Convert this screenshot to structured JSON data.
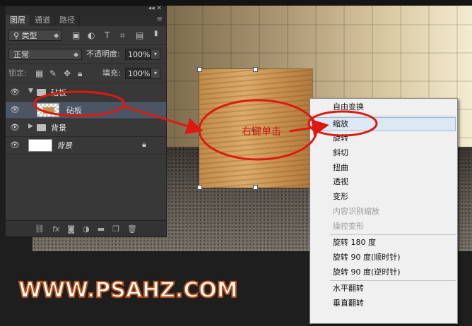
{
  "panel": {
    "tabs": [
      "图层",
      "通道",
      "路径"
    ],
    "filter_kind": "类型",
    "blend_mode": "正常",
    "opacity_label": "不透明度:",
    "opacity_value": "100%",
    "lock_label": "锁定:",
    "fill_label": "填充:",
    "fill_value": "100%",
    "layers": [
      {
        "name": "砧板",
        "type": "group",
        "visible": true
      },
      {
        "name": "砧板",
        "type": "layer",
        "visible": true,
        "selected": true
      },
      {
        "name": "背景",
        "type": "group",
        "visible": true
      },
      {
        "name": "背景",
        "type": "background",
        "visible": true,
        "locked": true
      }
    ],
    "bottom_icons": [
      "link-icon",
      "fx-icon",
      "mask-icon",
      "adjustment-icon",
      "folder-icon",
      "new-layer-icon",
      "trash-icon"
    ]
  },
  "context_menu": {
    "items": [
      {
        "label": "自由变换",
        "enabled": true
      },
      {
        "label": "缩放",
        "enabled": true,
        "highlighted": true
      },
      {
        "label": "旋转",
        "enabled": true
      },
      {
        "label": "斜切",
        "enabled": true
      },
      {
        "label": "扭曲",
        "enabled": true
      },
      {
        "label": "透视",
        "enabled": true
      },
      {
        "label": "变形",
        "enabled": true
      },
      {
        "label": "内容识别缩放",
        "enabled": false
      },
      {
        "label": "操控变形",
        "enabled": false
      },
      {
        "label": "旋转 180 度",
        "enabled": true
      },
      {
        "label": "旋转 90 度(顺时针)",
        "enabled": true
      },
      {
        "label": "旋转 90 度(逆时针)",
        "enabled": true
      },
      {
        "label": "水平翻转",
        "enabled": true
      },
      {
        "label": "垂直翻转",
        "enabled": true
      }
    ]
  },
  "annotation": {
    "text": "右键单击",
    "color": "#cc1a12"
  },
  "watermark": "WWW.PSAHZ.COM"
}
